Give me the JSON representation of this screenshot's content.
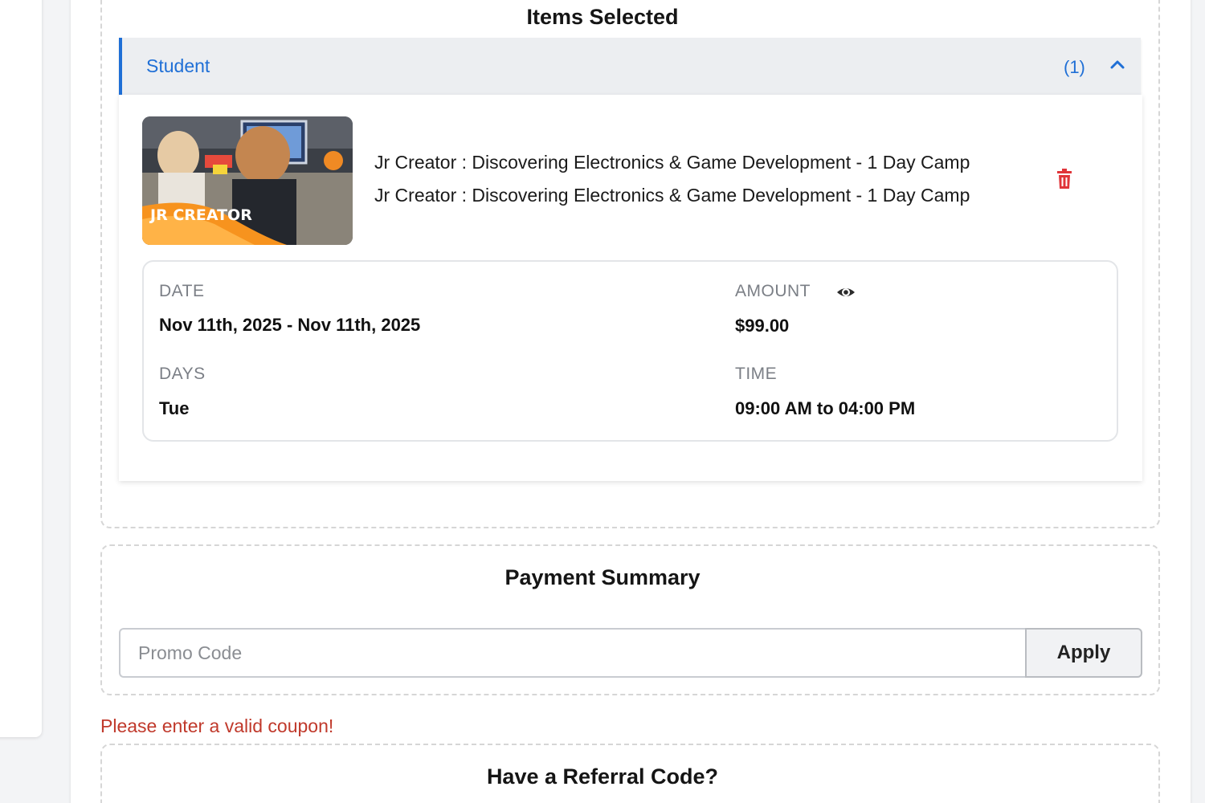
{
  "items_section": {
    "title": "Items Selected",
    "accordion": {
      "label": "Student",
      "count": "(1)",
      "expanded": true,
      "toggle_icon": "chevron-up-icon"
    },
    "item": {
      "thumbnail_caption": "JR CREATOR",
      "name_line_1": "Jr Creator : Discovering Electronics & Game Development - 1 Day Camp",
      "name_line_2": "Jr Creator : Discovering Electronics & Game Development - 1 Day Camp",
      "delete_icon": "trash-icon",
      "date_label": "DATE",
      "date_value": "Nov 11th, 2025 - Nov 11th, 2025",
      "amount_label": "AMOUNT",
      "amount_icon": "eye-icon",
      "amount_value": "$99.00",
      "days_label": "DAYS",
      "days_value": "Tue",
      "time_label": "TIME",
      "time_value": "09:00 AM to 04:00 PM"
    }
  },
  "payment_section": {
    "title": "Payment Summary",
    "promo_placeholder": "Promo Code",
    "promo_value": "",
    "apply_label": "Apply",
    "error_message": "Please enter a valid coupon!"
  },
  "referral_section": {
    "title": "Have a Referral Code?"
  },
  "colors": {
    "accent": "#1f6fd6",
    "error": "#c0392b",
    "delete": "#e0353a",
    "header_bg": "#eceef1"
  }
}
